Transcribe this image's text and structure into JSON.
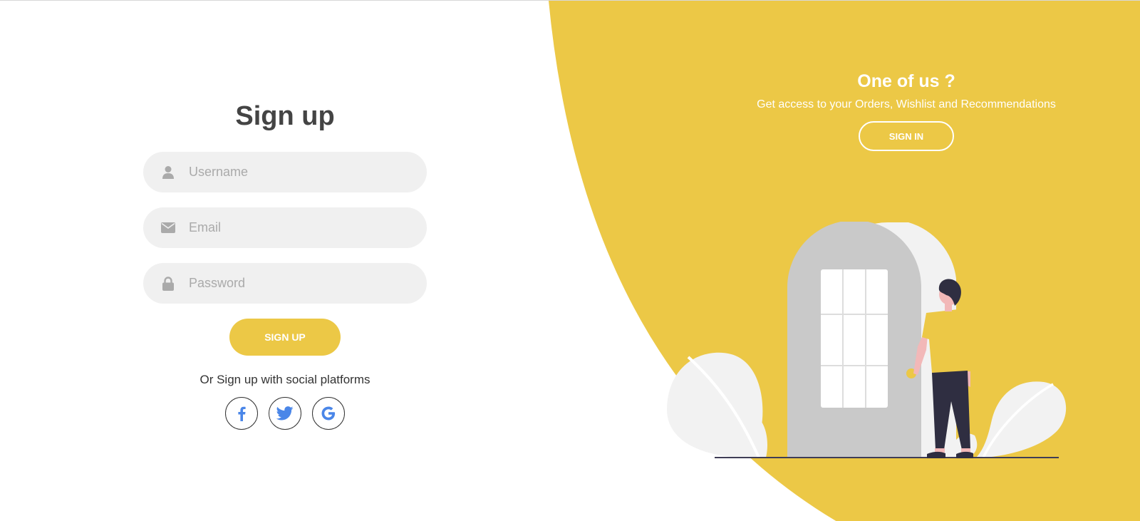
{
  "colors": {
    "accent": "#ecc846",
    "field_bg": "#f0f0f0",
    "title_text": "#444444",
    "placeholder": "#aaaaaa"
  },
  "signup": {
    "title": "Sign up",
    "username_placeholder": "Username",
    "email_placeholder": "Email",
    "password_placeholder": "Password",
    "button_label": "SIGN UP",
    "social_text": "Or Sign up with social platforms",
    "social": [
      {
        "icon": "facebook-icon"
      },
      {
        "icon": "twitter-icon"
      },
      {
        "icon": "google-icon"
      }
    ]
  },
  "panel": {
    "title": "One of us ?",
    "text": "Get access to your Orders, Wishlist and Recommendations",
    "button_label": "SIGN IN"
  }
}
